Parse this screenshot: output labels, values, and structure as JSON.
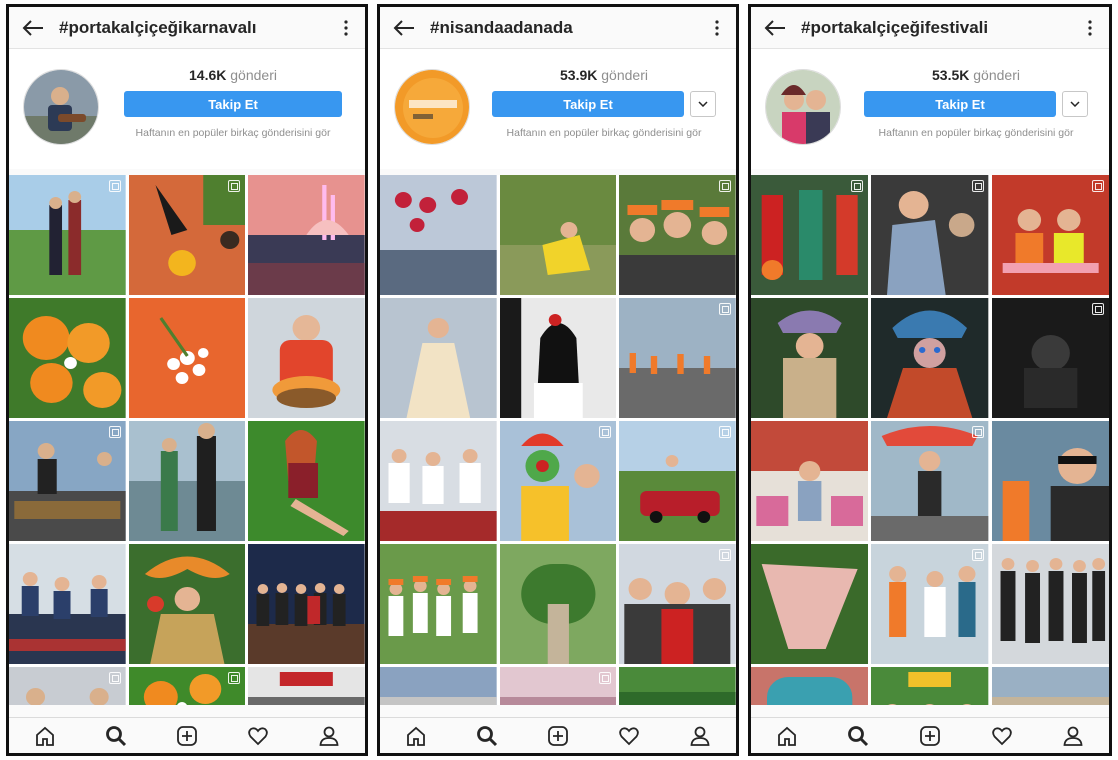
{
  "panels": [
    {
      "hashtag": "#portakalçiçeğikarnavalı",
      "post_count": "14.6K",
      "post_label": "gönderi",
      "follow_label": "Takip Et",
      "has_dropdown": false,
      "description": "Haftanın en popüler birkaç gönderisini gör"
    },
    {
      "hashtag": "#nisandaadanada",
      "post_count": "53.9K",
      "post_label": "gönderi",
      "follow_label": "Takip Et",
      "has_dropdown": true,
      "description": "Haftanın en popüler birkaç gönderisini gör"
    },
    {
      "hashtag": "#portakalçiçeğifestivali",
      "post_count": "53.5K",
      "post_label": "gönderi",
      "follow_label": "Takip Et",
      "has_dropdown": true,
      "description": "Haftanın en popüler birkaç gönderisini gör"
    }
  ],
  "nav_icons": [
    "home-icon",
    "search-icon",
    "add-post-icon",
    "heart-icon",
    "profile-icon"
  ],
  "colors": {
    "follow_button": "#3897f0",
    "text_primary": "#262626",
    "text_secondary": "#8e8e8e"
  }
}
